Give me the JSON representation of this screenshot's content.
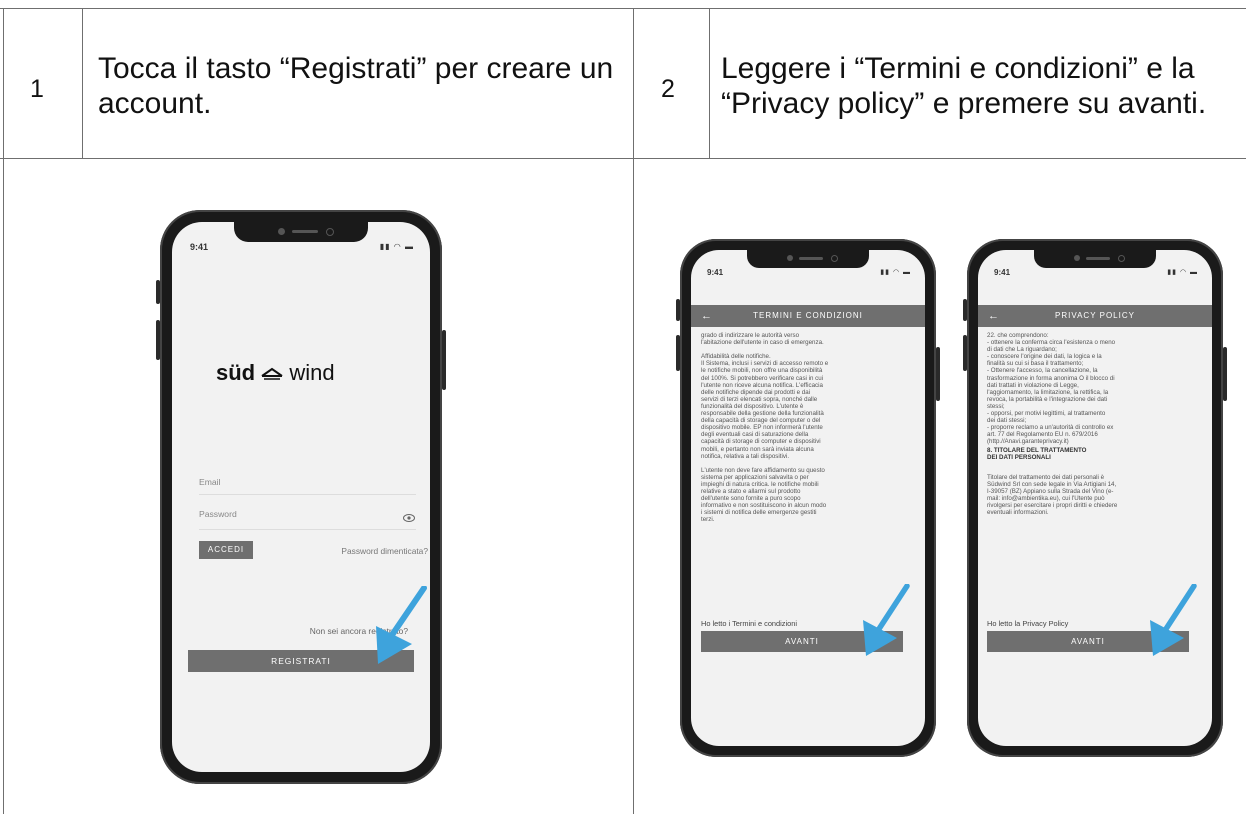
{
  "steps": [
    {
      "number": "1",
      "text": "Tocca il tasto “Registrati” per creare un account."
    },
    {
      "number": "2",
      "text": "Leggere i “Termini e condizioni” e la “Privacy policy” e premere su avanti."
    }
  ],
  "phone1": {
    "time": "9:41",
    "logo_left": "süd",
    "logo_right": "wind",
    "email_label": "Email",
    "password_label": "Password",
    "login_button": "ACCEDI",
    "forgot_link": "Password dimenticata?",
    "not_registered": "Non sei ancora registrato?",
    "register_button": "REGISTRATI"
  },
  "phone2": {
    "time": "9:41",
    "back": "←",
    "title": "TERMINI E CONDIZIONI",
    "body": "grado di indirizzare le autorità verso\nl'abitazione dell'utente in caso di emergenza.\n\nAffidabilità delle notifiche.\nIl Sistema, inclusi i servizi di accesso remoto e\nle notifiche mobili, non offre una disponibilità\ndel 100%. Si potrebbero verificare casi in cui\nl'utente non riceve alcuna notifica. L'efficacia\ndelle notifiche dipende dai prodotti e dai\nservizi di terzi elencati sopra, nonché dalle\nfunzionalità del dispositivo. L'utente è\nresponsabile della gestione della funzionalità\ndella capacità di storage del computer o del\ndispositivo mobile. EP non informerà l'utente\ndegli eventuali casi di saturazione della\ncapacità di storage di computer e dispositivi\nmobili, e pertanto non sarà inviata alcuna\nnotifica, relativa a tali dispositivi.\n\nL'utente non deve fare affidamento su questo\nsistema per applicazioni salvavita o per\nimpieghi di natura critica. le notifiche mobili\nrelative a stato e allarmi sul prodotto\ndell'utente sono fornite a puro scopo\ninformativo e non sostituiscono in alcun modo\ni sistemi di notifica delle emergenze gestiti\nterzi.",
    "read_label": "Ho letto i Termini e condizioni",
    "next_button": "AVANTI"
  },
  "phone3": {
    "time": "9:41",
    "back": "←",
    "title": "PRIVACY POLICY",
    "body_a": "22. che comprendono:\n- ottenere la conferma circa l'esistenza o meno\ndi dati che La riguardano;\n- conoscere l'origine dei dati, la logica e la\nfinalità su cui si basa il trattamento;\n- Ottenere l'accesso, la cancellazione, la\ntrasformazione in forma anonima O il blocco di\ndati trattati in violazione di Legge,\nl'aggiornamento, la limitazione, la rettifica, la\nrevoca, la portabilità e l'integrazione dei dati\nstessi;\n- opporsi, per motivi legittimi, al trattamento\ndei dati stessi;\n- proporre reclamo a un'autorità di controllo ex\nart. 77 del Regolamento EU n. 679/2016\n(http.//Anavi.garanteprivacy.it)",
    "section_title": "8. TITOLARE DEL TRATTAMENTO\nDEI DATI PERSONALI",
    "body_b": "Titolare del trattamento dei dati personali è\nSüdwind Srl con sede legale in Via Artigiani 14,\nI-39057 (BZ) Appiano sulla Strada del Vino (e-\nmail: info@ambientika.eu), cui l'Utente può\nrivolgersi per esercitare i propri diritti e chiedere\neventuali informazioni.",
    "read_label": "Ho letto la Privacy Policy",
    "next_button": "AVANTI"
  },
  "colors": {
    "accent_arrow": "#3ea3dc",
    "header_gray": "#6f6f6f",
    "grid": "#6f6f6f"
  }
}
